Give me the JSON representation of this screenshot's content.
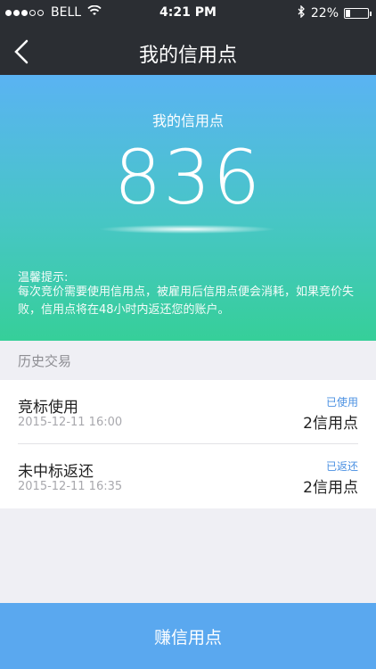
{
  "status_bar": {
    "carrier": "BELL",
    "time": "4:21 PM",
    "battery_percent": "22%",
    "battery_level": 0.22,
    "signal_dots_filled": 3,
    "signal_dots_total": 5
  },
  "nav": {
    "title": "我的信用点",
    "back_icon": "chevron-left-icon"
  },
  "credits": {
    "label": "我的信用点",
    "value": "836",
    "tip_title": "温馨提示:",
    "tip_text": "每次竞价需要使用信用点，被雇用后信用点便会消耗，如果竞价失败，信用点将在48小时内返还您的账户。"
  },
  "history": {
    "header": "历史交易",
    "items": [
      {
        "title": "竞标使用",
        "date": "2015-12-11 16:00",
        "status": "已使用",
        "amount": "2信用点"
      },
      {
        "title": "未中标返还",
        "date": "2015-12-11 16:35",
        "status": "已返还",
        "amount": "2信用点"
      }
    ]
  },
  "bottom_button": {
    "label": "赚信用点"
  },
  "colors": {
    "nav_bg": "#2b2e33",
    "gradient_top": "#5ab3f3",
    "gradient_bottom": "#36cf99",
    "status_blue": "#4a90e2",
    "button_bg": "#5aa8ef"
  }
}
